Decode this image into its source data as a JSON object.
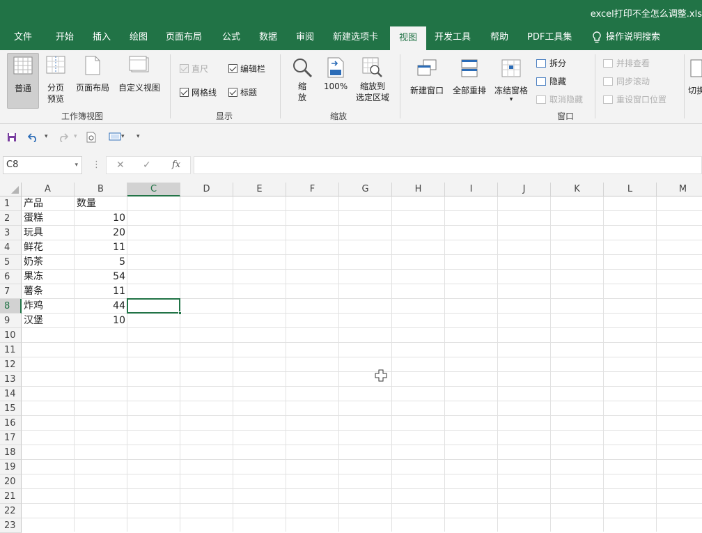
{
  "window": {
    "title": "excel打印不全怎么调整.xls"
  },
  "menu": {
    "tabs": [
      "文件",
      "开始",
      "插入",
      "绘图",
      "页面布局",
      "公式",
      "数据",
      "审阅",
      "新建选项卡",
      "视图",
      "开发工具",
      "帮助",
      "PDF工具集"
    ],
    "active": "视图",
    "tell_me": "操作说明搜索"
  },
  "ribbon": {
    "workbook_views": {
      "label": "工作簿视图",
      "normal": "普通",
      "page_break_1": "分页",
      "page_break_2": "预览",
      "page_layout": "页面布局",
      "custom_views": "自定义视图"
    },
    "show": {
      "label": "显示",
      "ruler": "直尺",
      "formula_bar": "编辑栏",
      "gridlines": "网格线",
      "headings": "标题"
    },
    "zoom": {
      "label": "缩放",
      "zoom_1": "缩",
      "zoom_2": "放",
      "hundred": "100%",
      "zoom_sel_1": "缩放到",
      "zoom_sel_2": "选定区域"
    },
    "window": {
      "label": "窗口",
      "new_window": "新建窗口",
      "arrange_all": "全部重排",
      "freeze_panes": "冻结窗格",
      "freeze_arrow": "▾",
      "split": "拆分",
      "hide": "隐藏",
      "unhide": "取消隐藏",
      "side_by_side": "并排查看",
      "sync_scroll": "同步滚动",
      "reset_position": "重设窗口位置",
      "switch": "切换"
    }
  },
  "qat": {
    "sep": "▾"
  },
  "formula_bar": {
    "name_box": "C8",
    "name_dd": "▾",
    "dots": "⋮",
    "cancel": "✕",
    "enter": "✓",
    "fx": "fx",
    "content": ""
  },
  "sheet": {
    "columns": [
      "A",
      "B",
      "C",
      "D",
      "E",
      "F",
      "G",
      "H",
      "I",
      "J",
      "K",
      "L",
      "M"
    ],
    "selected_column": "C",
    "rows": [
      "1",
      "2",
      "3",
      "4",
      "5",
      "6",
      "7",
      "8",
      "9",
      "10",
      "11",
      "12",
      "13",
      "14",
      "15",
      "16",
      "17",
      "18",
      "19",
      "20",
      "21",
      "22",
      "23"
    ],
    "selected_row": "8",
    "selected_cell": "C8",
    "header": {
      "A": "产品",
      "B": "数量"
    },
    "data": [
      {
        "product": "蛋糕",
        "qty": "10"
      },
      {
        "product": "玩具",
        "qty": "20"
      },
      {
        "product": "鲜花",
        "qty": "11"
      },
      {
        "product": "奶茶",
        "qty": "5"
      },
      {
        "product": "果冻",
        "qty": "54"
      },
      {
        "product": "薯条",
        "qty": "11"
      },
      {
        "product": "炸鸡",
        "qty": "44"
      },
      {
        "product": "汉堡",
        "qty": "10"
      }
    ]
  },
  "colors": {
    "accent": "#217346",
    "ribbon_bg": "#f3f3f3"
  }
}
